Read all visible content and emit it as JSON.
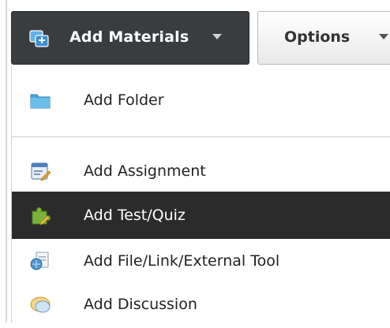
{
  "toolbar": {
    "add_materials": {
      "label": "Add Materials",
      "icon": "add-materials-icon"
    },
    "options": {
      "label": "Options"
    }
  },
  "menu": {
    "items": [
      {
        "label": "Add Folder",
        "icon": "folder-icon"
      },
      {
        "label": "Add Assignment",
        "icon": "assignment-icon"
      },
      {
        "label": "Add Test/Quiz",
        "icon": "test-quiz-icon",
        "highlighted": true
      },
      {
        "label": "Add File/Link/External Tool",
        "icon": "file-link-icon"
      },
      {
        "label": "Add Discussion",
        "icon": "discussion-icon"
      }
    ]
  },
  "colors": {
    "toolbar_dark": "#3a3d40",
    "menu_highlight": "#2b2b2b",
    "folder_blue": "#4aa3d8",
    "quiz_green": "#7bb23a"
  }
}
